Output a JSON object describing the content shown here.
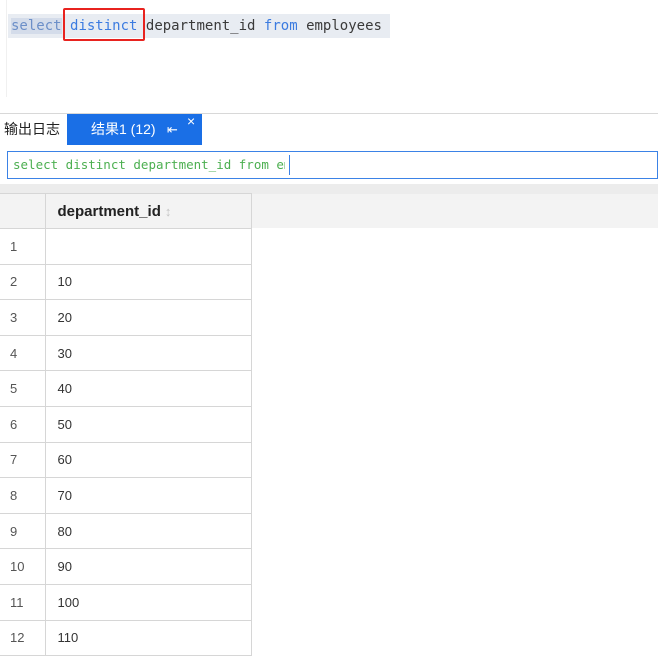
{
  "editor": {
    "kw_select": "select",
    "kw_distinct": "distinct",
    "ident_department": "department_id",
    "kw_from": "from",
    "ident_table": "employees"
  },
  "tabs": {
    "log_label": "输出日志",
    "result_label": "结果1 (12)",
    "pin_glyph": "⇤",
    "close_glyph": "×"
  },
  "sql_bar": {
    "text": "select distinct department_id from em"
  },
  "grid": {
    "columns": [
      "department_id"
    ],
    "rows": [
      {
        "num": "1",
        "value": ""
      },
      {
        "num": "2",
        "value": "10"
      },
      {
        "num": "3",
        "value": "20"
      },
      {
        "num": "4",
        "value": "30"
      },
      {
        "num": "5",
        "value": "40"
      },
      {
        "num": "6",
        "value": "50"
      },
      {
        "num": "7",
        "value": "60"
      },
      {
        "num": "8",
        "value": "70"
      },
      {
        "num": "9",
        "value": "80"
      },
      {
        "num": "10",
        "value": "90"
      },
      {
        "num": "11",
        "value": "100"
      },
      {
        "num": "12",
        "value": "110"
      }
    ]
  },
  "colors": {
    "keyword": "#3b7be0",
    "tab_active": "#1a6fe6",
    "highlight_box": "#e8231f",
    "sql_text": "#4caf50"
  }
}
